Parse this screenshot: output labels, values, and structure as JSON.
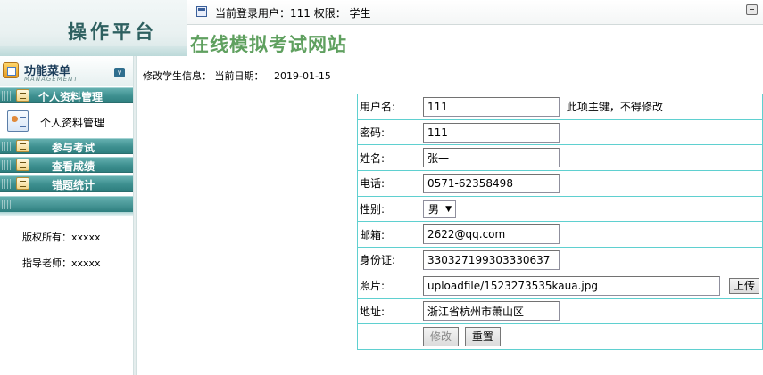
{
  "header": {
    "logo_text": "操作平台",
    "user_info": "当前登录用户：111 权限： 学生",
    "site_title": "在线模拟考试网站"
  },
  "sidebar": {
    "menu_title": "功能菜单",
    "menu_subtitle": "MANAGEMENT",
    "sections": [
      {
        "label": "个人资料管理"
      },
      {
        "label": "参与考试"
      },
      {
        "label": "查看成绩"
      },
      {
        "label": "错题统计"
      }
    ],
    "sub_item": "个人资料管理",
    "copyright": "版权所有：xxxxx",
    "advisor": "指导老师：xxxxx"
  },
  "main": {
    "crumb": "修改学生信息：",
    "date_label": "当前日期：",
    "date_value": "2019-01-15",
    "form": {
      "username_label": "用户名:",
      "username_value": "111",
      "username_note": "此项主键，不得修改",
      "password_label": "密码:",
      "password_value": "111",
      "name_label": "姓名:",
      "name_value": "张一",
      "phone_label": "电话:",
      "phone_value": "0571-62358498",
      "gender_label": "性别:",
      "gender_value": "男",
      "email_label": "邮箱:",
      "email_value": "2622@qq.com",
      "id_label": "身份证:",
      "id_value": "330327199303330637",
      "photo_label": "照片:",
      "photo_value": "uploadfile/1523273535kaua.jpg",
      "upload_label": "上传",
      "address_label": "地址:",
      "address_value": "浙江省杭州市萧山区",
      "submit_label": "修改",
      "reset_label": "重置"
    }
  }
}
